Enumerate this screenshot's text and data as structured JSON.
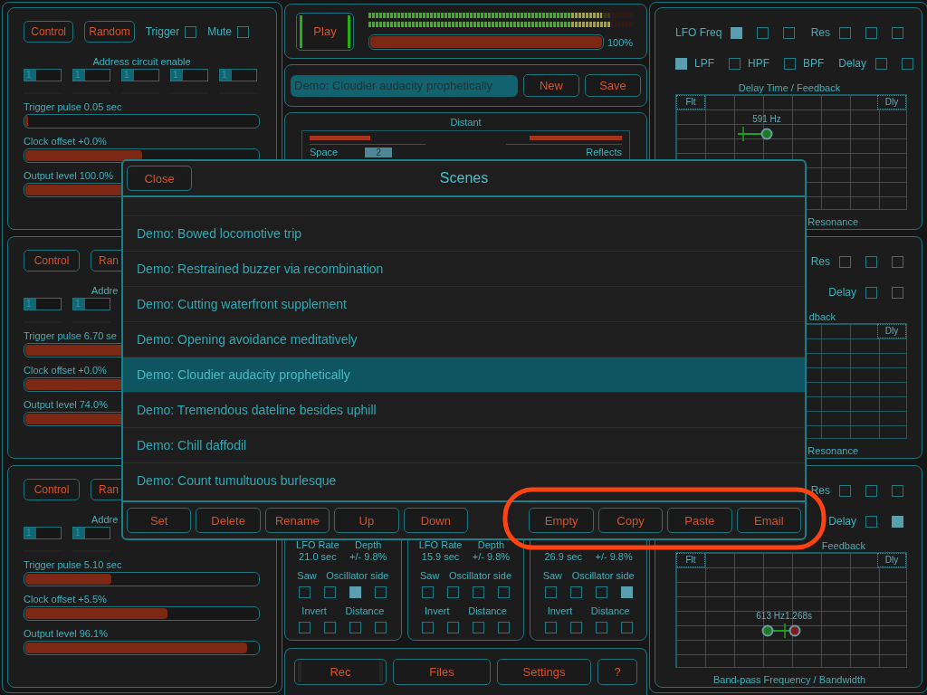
{
  "left_panels": [
    {
      "buttons": [
        {
          "label": "Control"
        },
        {
          "label": "Random"
        }
      ],
      "toggles": [
        {
          "label": "Trigger",
          "checked": false
        },
        {
          "label": "Mute",
          "checked": false
        }
      ],
      "address_label": "Address circuit enable",
      "switches": [
        {
          "label": "1",
          "on": true
        },
        {
          "label": "1",
          "on": true
        },
        {
          "label": "1",
          "on": true
        },
        {
          "label": "1",
          "on": true
        },
        {
          "label": "1",
          "on": true
        }
      ],
      "sliders": [
        {
          "label": "Trigger pulse 0.05 sec",
          "level": 0.01
        },
        {
          "label": "Clock offset +0.0%",
          "level": 0.5
        },
        {
          "label": "Output level 100.0%",
          "level": 1.0
        }
      ]
    },
    {
      "buttons": [
        {
          "label": "Control"
        },
        {
          "label": "Ran"
        }
      ],
      "address_label": "Addre",
      "switches": [
        {
          "label": "1",
          "on": true
        },
        {
          "label": "1",
          "on": true
        }
      ],
      "sliders": [
        {
          "label": "Trigger pulse 6.70 se",
          "level": 0.47
        },
        {
          "label": "Clock offset +0.0%",
          "level": 0.5
        },
        {
          "label": "Output level 74.0%",
          "level": 0.74
        }
      ]
    },
    {
      "buttons": [
        {
          "label": "Control"
        },
        {
          "label": "Ran"
        }
      ],
      "address_label": "Addre",
      "switches": [
        {
          "label": "1",
          "on": true
        },
        {
          "label": "1",
          "on": true
        }
      ],
      "sliders": [
        {
          "label": "Trigger pulse 5.10 sec",
          "level": 0.37
        },
        {
          "label": "Clock offset +5.5%",
          "level": 0.61
        },
        {
          "label": "Output level 96.1%",
          "level": 0.955
        }
      ]
    }
  ],
  "transport": {
    "play": "Play",
    "meters": [
      {
        "level": 0.88
      },
      {
        "level": 0.91
      }
    ],
    "volume": {
      "level": 1.0,
      "reading": "100%"
    }
  },
  "scene_bar": {
    "field": "Demo: Cloudier audacity prophetically",
    "buttons": [
      "New",
      "Save"
    ]
  },
  "distant": {
    "title": "Distant",
    "left": {
      "label": "Space",
      "level": 0.52
    },
    "value": "2",
    "right": {
      "label": "Reflects",
      "level": 0.8
    }
  },
  "lfo_panels": [
    {
      "rate_label": "LFO Rate",
      "rate": "21.0 sec",
      "depth_label": "Depth",
      "depth": "+/- 9.8%",
      "saw_label": "Saw",
      "side_label": "Oscillator side",
      "side": [
        {
          "checked": false
        },
        {
          "checked": false
        },
        {
          "checked": true
        },
        {
          "checked": false
        }
      ],
      "invert_label": "Invert",
      "distance_label": "Distance",
      "distance": [
        {
          "checked": false
        },
        {
          "checked": false
        },
        {
          "checked": false
        },
        {
          "checked": false
        }
      ]
    },
    {
      "rate_label": "LFO Rate",
      "rate": "15.9 sec",
      "depth_label": "Depth",
      "depth": "+/- 9.8%",
      "saw_label": "Saw",
      "side_label": "Oscillator side",
      "side": [
        {
          "checked": false
        },
        {
          "checked": false
        },
        {
          "checked": false
        },
        {
          "checked": false
        }
      ],
      "invert_label": "Invert",
      "distance_label": "Distance",
      "distance": [
        {
          "checked": false
        },
        {
          "checked": false
        },
        {
          "checked": false
        },
        {
          "checked": false
        }
      ]
    },
    {
      "rate": "26.9 sec",
      "depth": "+/- 9.8%",
      "saw_label": "Saw",
      "side_label": "Oscillator side",
      "side": [
        {
          "checked": false
        },
        {
          "checked": false
        },
        {
          "checked": false
        },
        {
          "checked": true
        }
      ],
      "invert_label": "Invert",
      "distance_label": "Distance",
      "distance": [
        {
          "checked": false
        },
        {
          "checked": false
        },
        {
          "checked": false
        },
        {
          "checked": false
        }
      ]
    }
  ],
  "bottom_bar": [
    "Rec",
    "Files",
    "Settings",
    "?"
  ],
  "right_panels": [
    {
      "lfo": {
        "label": "LFO Freq",
        "boxes": [
          {
            "checked": true
          },
          {
            "checked": false
          },
          {
            "checked": false
          }
        ]
      },
      "res": {
        "label": "Res",
        "boxes": [
          {
            "checked": false
          },
          {
            "checked": false
          },
          {
            "checked": false
          }
        ]
      },
      "filters": [
        {
          "label": "LPF",
          "checked": true
        },
        {
          "label": "HPF",
          "checked": false
        },
        {
          "label": "BPF",
          "checked": false
        }
      ],
      "delay": {
        "label": "Delay",
        "boxes": [
          {
            "checked": false
          },
          {
            "checked": false
          }
        ]
      },
      "caption_top": "Delay Time / Feedback",
      "tabs": [
        {
          "label": "Flt",
          "kind": "filter"
        },
        {
          "label": "Dly",
          "kind": "delay"
        }
      ],
      "points": [
        {
          "label": "591 Hz",
          "color": "#1c7a22"
        }
      ],
      "caption_bottom": "Resonance"
    },
    {
      "res": {
        "label": "Res",
        "boxes": [
          {
            "checked": false
          },
          {
            "checked": false
          },
          {
            "checked": false
          }
        ]
      },
      "delay": {
        "label": "Delay",
        "boxes": [
          {
            "checked": false
          },
          {
            "checked": false
          }
        ]
      },
      "caption_top": "dback",
      "tabs": [
        {
          "label": "Dly",
          "kind": "delay"
        }
      ],
      "caption_bottom": "Resonance"
    },
    {
      "res": {
        "label": "Res",
        "boxes": [
          {
            "checked": false
          },
          {
            "checked": false
          },
          {
            "checked": false
          }
        ]
      },
      "delay": {
        "label": "Delay",
        "boxes": [
          {
            "checked": false
          },
          {
            "checked": true
          }
        ]
      },
      "caption_top": "Feedback",
      "tabs": [
        {
          "label": "Flt",
          "kind": "filter"
        },
        {
          "label": "Dly",
          "kind": "delay"
        }
      ],
      "points": [
        {
          "label": "613 Hz",
          "color": "#1c7a22"
        },
        {
          "label": "1.268s",
          "color": "#7a1c1c"
        }
      ],
      "caption_bottom": "Band-pass Frequency / Bandwidth"
    }
  ],
  "dialog": {
    "close": "Close",
    "title": "Scenes",
    "scenes": [
      {
        "name": "Demo: Bowed locomotive trip",
        "selected": false
      },
      {
        "name": "Demo: Restrained buzzer via recombination",
        "selected": false
      },
      {
        "name": "Demo: Cutting waterfront supplement",
        "selected": false
      },
      {
        "name": "Demo: Opening avoidance meditatively",
        "selected": false
      },
      {
        "name": "Demo: Cloudier audacity prophetically",
        "selected": true
      },
      {
        "name": "Demo: Tremendous dateline besides uphill",
        "selected": false
      },
      {
        "name": "Demo: Chill daffodil",
        "selected": false
      },
      {
        "name": "Demo: Count tumultuous burlesque",
        "selected": false
      }
    ],
    "actions": [
      "Set",
      "Delete",
      "Rename",
      "Up",
      "Down"
    ],
    "clipboard_actions": [
      "Empty",
      "Copy",
      "Paste",
      "Email"
    ]
  }
}
